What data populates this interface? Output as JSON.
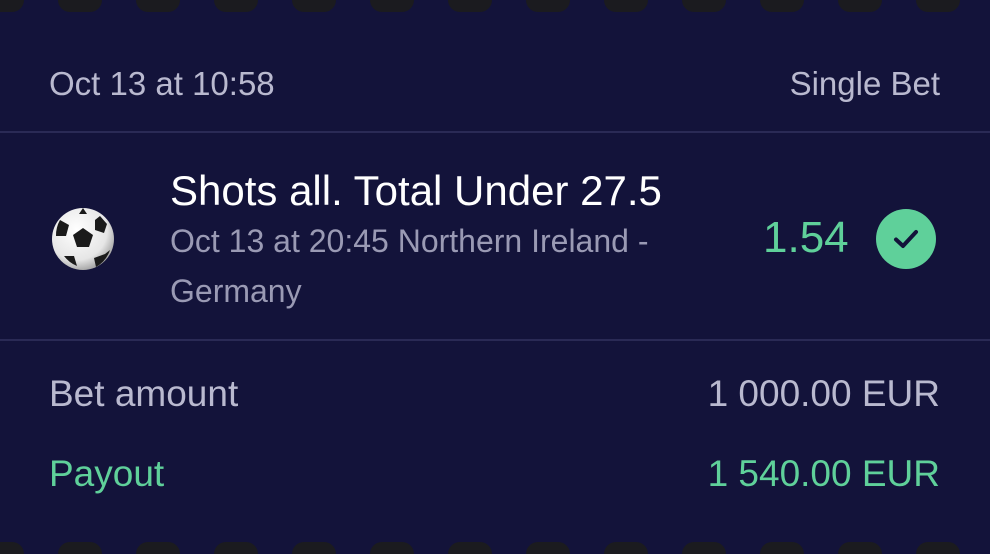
{
  "header": {
    "placed_at": "Oct 13 at 10:58",
    "bet_type": "Single Bet"
  },
  "selection": {
    "sport_icon": "soccer-ball-icon",
    "market": "Shots all. Total Under 27.5",
    "event_time": "Oct 13 at 20:45",
    "match": "Northern Ireland - Germany",
    "details": "Oct 13 at 20:45 Northern Ireland - Germany",
    "odds": "1.54",
    "status_icon": "check-circle-icon"
  },
  "summary": {
    "bet_amount_label": "Bet amount",
    "bet_amount_value": "1 000.00 EUR",
    "payout_label": "Payout",
    "payout_value": "1 540.00 EUR"
  },
  "colors": {
    "background": "#13133a",
    "accent_green": "#5fd09a",
    "muted_text": "#b9b9cf",
    "divider": "#2a2a55"
  }
}
